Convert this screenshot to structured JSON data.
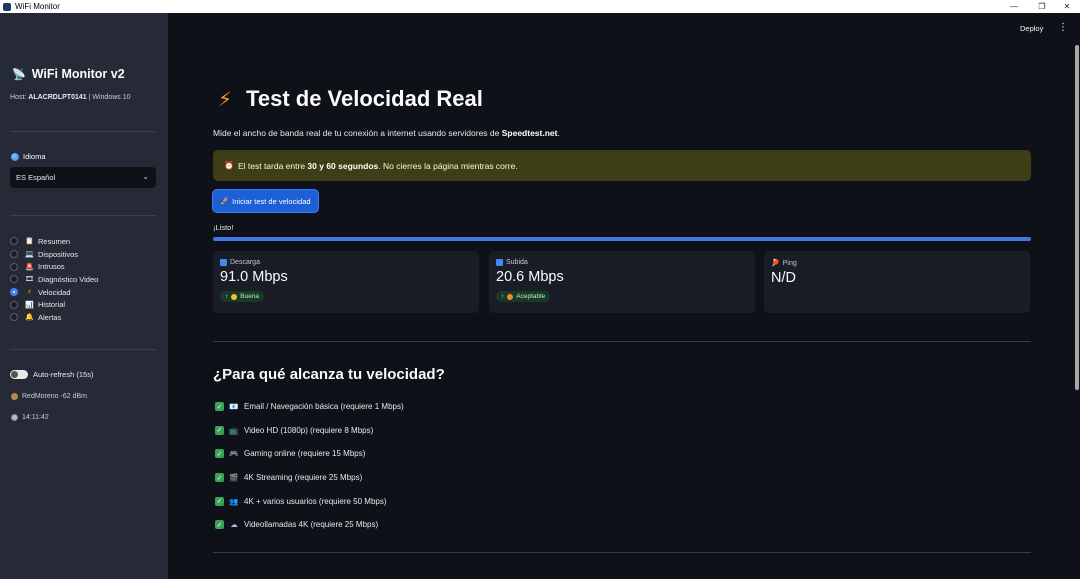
{
  "window": {
    "title": "WiFi Monitor",
    "minimize": "—",
    "maximize": "❐",
    "close": "✕"
  },
  "sidebar": {
    "brand": "WiFi Monitor v2",
    "host_prefix": "Host: ",
    "host_name": "ALACRDLPT0141",
    "host_suffix": " | Windows 10",
    "language_label": "Idioma",
    "language_value": "ES Español",
    "nav": [
      {
        "icon": "📋",
        "label": "Resumen",
        "selected": false
      },
      {
        "icon": "💻",
        "label": "Dispositivos",
        "selected": false
      },
      {
        "icon": "🚨",
        "label": "Intrusos",
        "selected": false
      },
      {
        "icon": "🎞",
        "label": "Diagnóstico Video",
        "selected": false
      },
      {
        "icon": "⚡",
        "label": "Velocidad",
        "selected": true
      },
      {
        "icon": "📊",
        "label": "Historial",
        "selected": false
      },
      {
        "icon": "🔔",
        "label": "Alertas",
        "selected": false
      }
    ],
    "autorefresh_label": "Auto-refresh (15s)",
    "autorefresh_on": false,
    "network": "RedMoreno -62 dBm",
    "time": "14:11:42"
  },
  "header": {
    "deploy": "Deploy",
    "menu": "⋮"
  },
  "main": {
    "title": "Test de Velocidad Real",
    "subtitle_prefix": "Mide el ancho de banda real de tu conexión a internet usando servidores de ",
    "subtitle_bold": "Speedtest.net",
    "subtitle_suffix": ".",
    "warning_prefix": "El test tarda entre ",
    "warning_bold": "30 y 60 segundos",
    "warning_suffix": ". No cierres la página mientras corre.",
    "button_label": "Iniciar test de velocidad",
    "status": "¡Listo!",
    "progress": 1.0,
    "metrics": [
      {
        "label": "Descarga",
        "value": "91.0 Mbps",
        "delta": "Buena"
      },
      {
        "label": "Subida",
        "value": "20.6 Mbps",
        "delta": "Aceptable"
      },
      {
        "label": "Ping",
        "value": "N/D"
      }
    ],
    "section_title": "¿Para qué alcanza tu velocidad?",
    "uses": [
      {
        "icon": "📧",
        "label": "Email / Navegación básica (requiere 1 Mbps)"
      },
      {
        "icon": "📺",
        "label": "Video HD (1080p) (requiere 8 Mbps)"
      },
      {
        "icon": "🎮",
        "label": "Gaming online (requiere 15 Mbps)"
      },
      {
        "icon": "🎬",
        "label": "4K Streaming (requiere 25 Mbps)"
      },
      {
        "icon": "👥",
        "label": "4K + varios usuarios (requiere 50 Mbps)"
      },
      {
        "icon": "☁",
        "label": "Videollamadas 4K (requiere 25 Mbps)"
      }
    ]
  }
}
